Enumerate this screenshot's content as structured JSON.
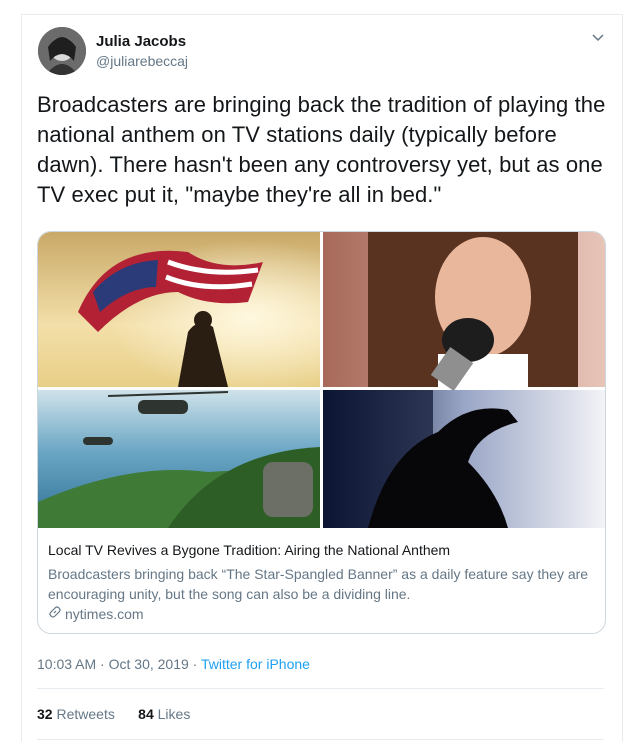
{
  "tweet": {
    "author_name": "Julia Jacobs",
    "author_handle": "@juliarebeccaj",
    "text": "Broadcasters are bringing back the tradition of playing the national anthem on TV stations daily (typically before dawn). There hasn't been any controversy yet, but as one TV exec put it, \"maybe they're all in bed.\"",
    "time": "10:03 AM",
    "separator": "·",
    "date": "Oct 30, 2019",
    "source": "Twitter for iPhone",
    "retweets_count": "32",
    "retweets_label": "Retweets",
    "likes_count": "84",
    "likes_label": "Likes"
  },
  "link_card": {
    "title": "Local TV Revives a Bygone Tradition: Airing the National Anthem",
    "description": "Broadcasters bringing back “The Star-Spangled Banner” as a daily feature say they are encouraging unity, but the song can also be a dividing line.",
    "domain": "nytimes.com",
    "images": [
      "flag-waving-photo",
      "girl-singing-photo",
      "helicopters-photo",
      "salute-photo"
    ]
  },
  "icons": {
    "caret": "chevron-down-icon",
    "link": "link-icon"
  },
  "colors": {
    "accent": "#1da1f2",
    "secondary_text": "#657786",
    "border": "#e6ecf0"
  }
}
